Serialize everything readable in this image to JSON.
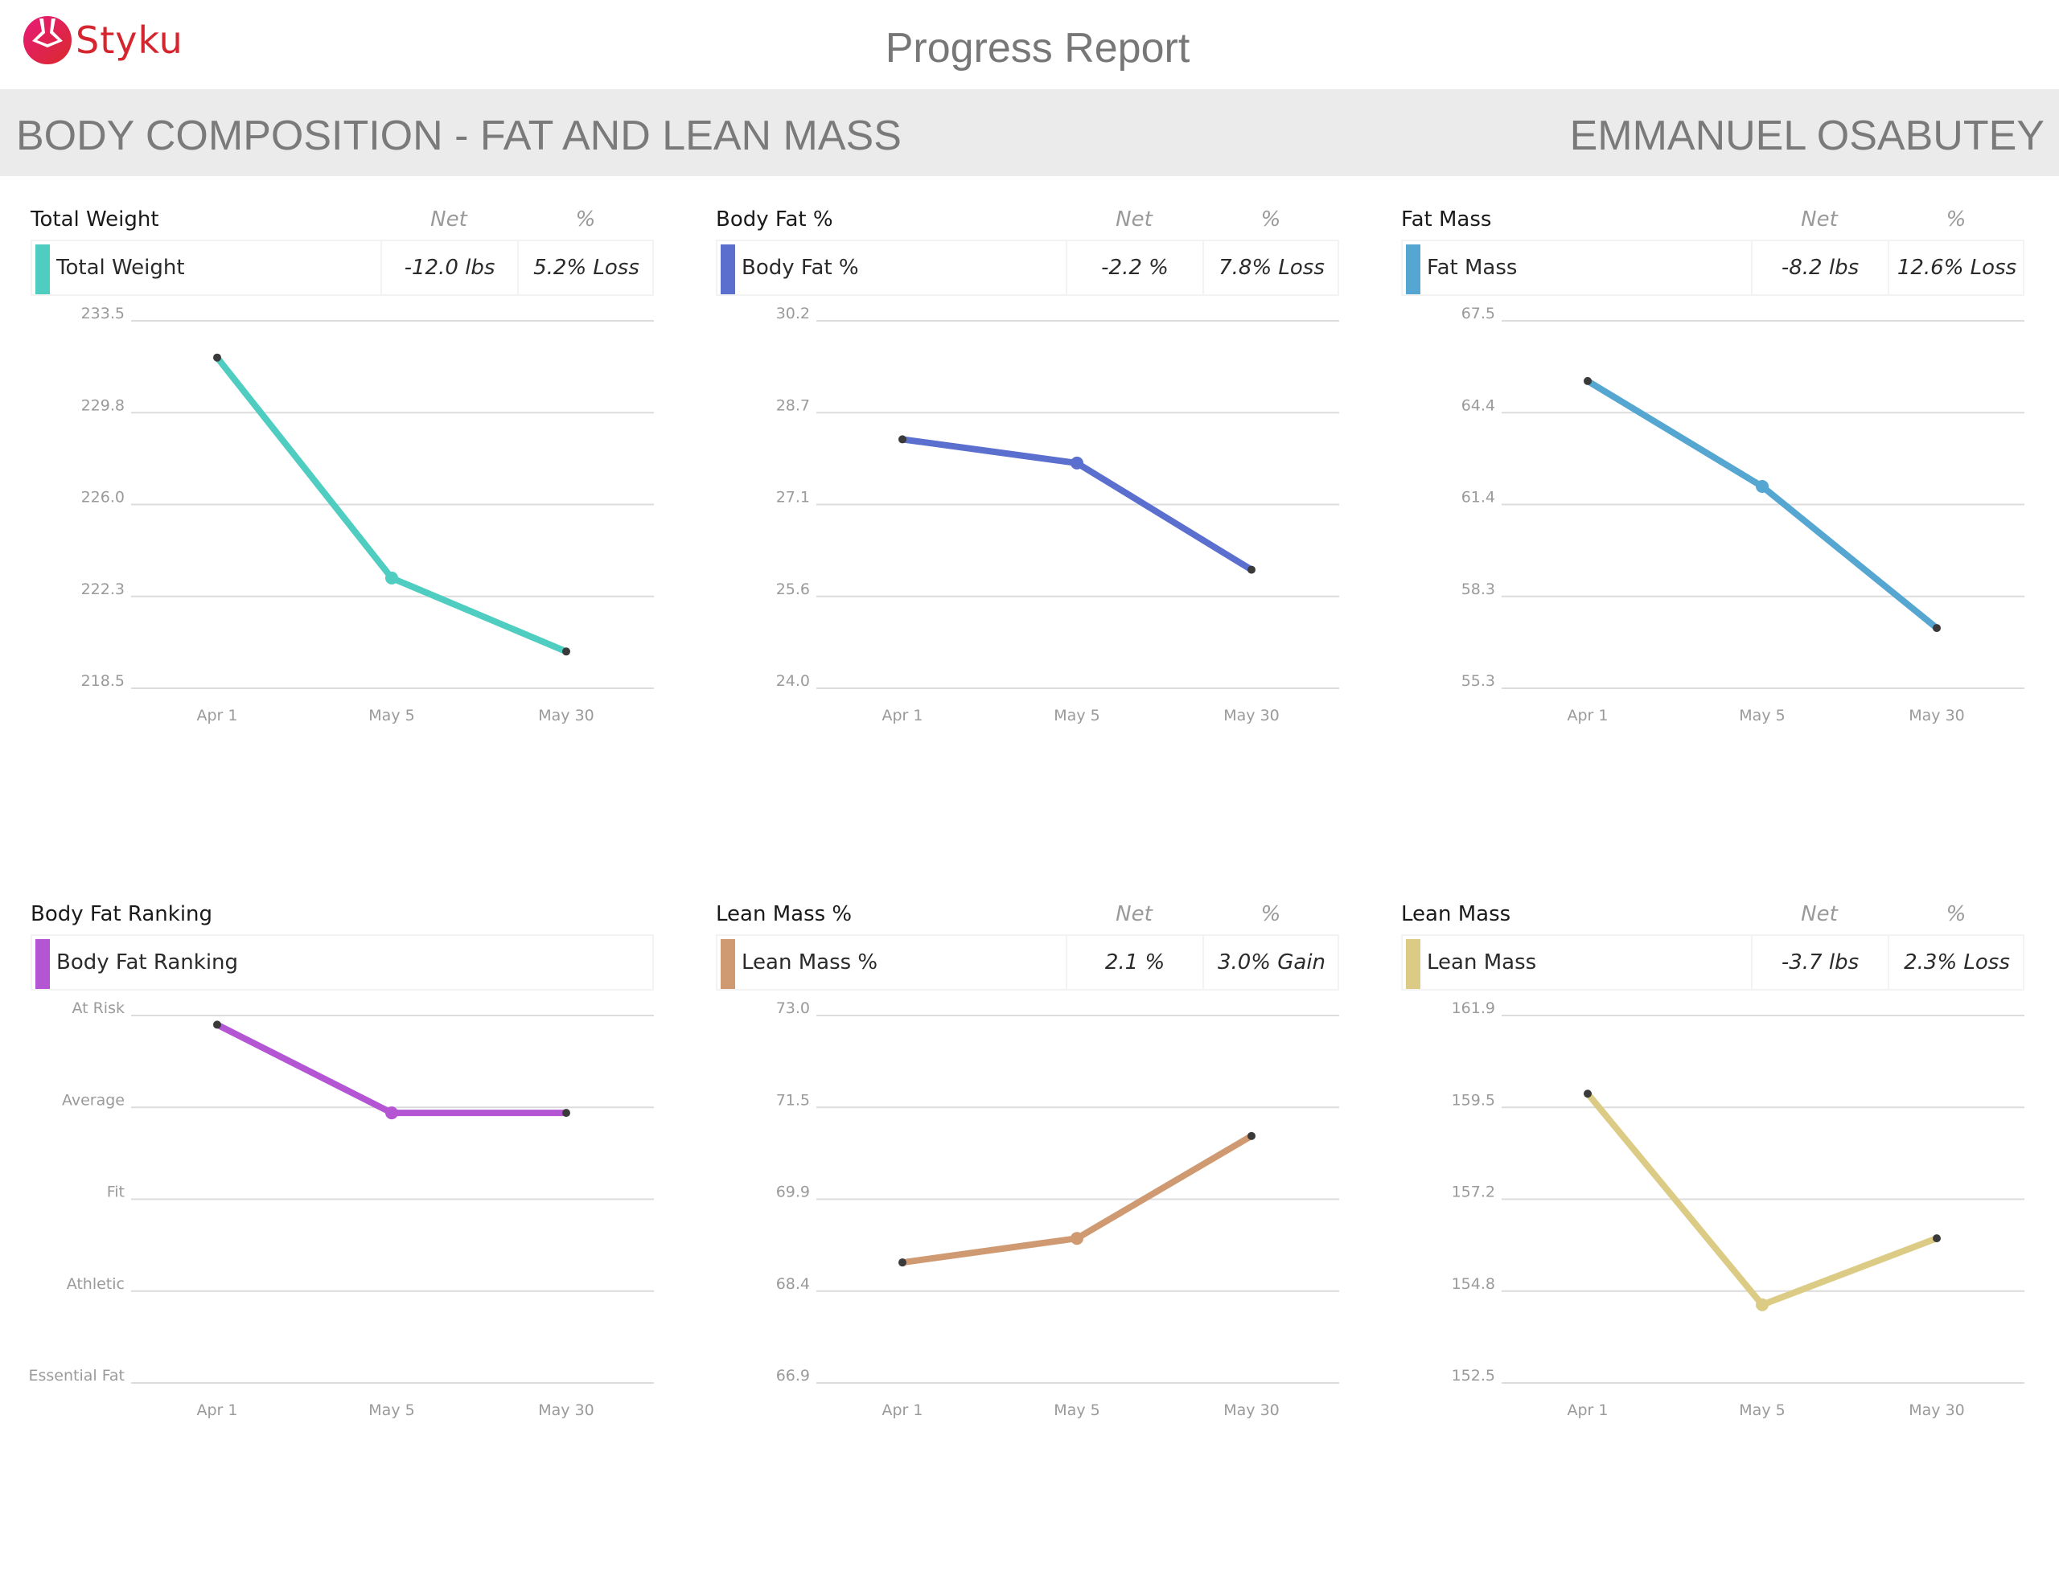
{
  "header": {
    "brand": "Styku",
    "report_title": "Progress Report",
    "section_title": "BODY COMPOSITION - FAT AND LEAN MASS",
    "client_name": "EMMANUEL OSABUTEY"
  },
  "table_headers": {
    "net": "Net",
    "pct": "%"
  },
  "panels": [
    {
      "title": "Total Weight",
      "row_label": "Total Weight",
      "net": "-12.0 lbs",
      "pct": "5.2% Loss",
      "color": "#4ecdc0"
    },
    {
      "title": "Body Fat %",
      "row_label": "Body Fat %",
      "net": "-2.2 %",
      "pct": "7.8% Loss",
      "color": "#5b6fcf"
    },
    {
      "title": "Fat Mass",
      "row_label": "Fat Mass",
      "net": "-8.2 lbs",
      "pct": "12.6% Loss",
      "color": "#55a6d0"
    },
    {
      "title": "Body Fat Ranking",
      "row_label": "Body Fat Ranking",
      "net": "",
      "pct": "",
      "color": "#b455d4"
    },
    {
      "title": "Lean Mass %",
      "row_label": "Lean Mass %",
      "net": "2.1 %",
      "pct": "3.0% Gain",
      "color": "#cf9a72"
    },
    {
      "title": "Lean Mass",
      "row_label": "Lean Mass",
      "net": "-3.7 lbs",
      "pct": "2.3% Loss",
      "color": "#dccb85"
    }
  ],
  "chart_data": [
    {
      "type": "line",
      "title": "Total Weight",
      "categories": [
        "Apr 1",
        "May 5",
        "May 30"
      ],
      "values": [
        232.0,
        223.0,
        220.0
      ],
      "yticks": [
        "233.5",
        "229.8",
        "226.0",
        "222.3",
        "218.5"
      ],
      "ylim": [
        218.5,
        233.5
      ],
      "grid": true
    },
    {
      "type": "line",
      "title": "Body Fat %",
      "categories": [
        "Apr 1",
        "May 5",
        "May 30"
      ],
      "values": [
        28.2,
        27.8,
        26.0
      ],
      "yticks": [
        "30.2",
        "28.7",
        "27.1",
        "25.6",
        "24.0"
      ],
      "ylim": [
        24.0,
        30.2
      ],
      "grid": true
    },
    {
      "type": "line",
      "title": "Fat Mass",
      "categories": [
        "Apr 1",
        "May 5",
        "May 30"
      ],
      "values": [
        65.5,
        62.0,
        57.3
      ],
      "yticks": [
        "67.5",
        "64.4",
        "61.4",
        "58.3",
        "55.3"
      ],
      "ylim": [
        55.3,
        67.5
      ],
      "grid": true
    },
    {
      "type": "line",
      "title": "Body Fat Ranking",
      "categories": [
        "Apr 1",
        "May 5",
        "May 30"
      ],
      "values": [
        3.9,
        2.94,
        2.94
      ],
      "yticks": [
        "At Risk",
        "Average",
        "Fit",
        "Athletic",
        "Essential Fat"
      ],
      "ylim": [
        0,
        4
      ],
      "ycategory_index": "Essential Fat=0, Athletic=1, Fit=2, Average=3, At Risk=4",
      "grid": true
    },
    {
      "type": "line",
      "title": "Lean Mass %",
      "categories": [
        "Apr 1",
        "May 5",
        "May 30"
      ],
      "values": [
        68.9,
        69.3,
        71.0
      ],
      "yticks": [
        "73.0",
        "71.5",
        "69.9",
        "68.4",
        "66.9"
      ],
      "ylim": [
        66.9,
        73.0
      ],
      "grid": true
    },
    {
      "type": "line",
      "title": "Lean Mass",
      "categories": [
        "Apr 1",
        "May 5",
        "May 30"
      ],
      "values": [
        159.9,
        154.5,
        156.2
      ],
      "yticks": [
        "161.9",
        "159.5",
        "157.2",
        "154.8",
        "152.5"
      ],
      "ylim": [
        152.5,
        161.9
      ],
      "grid": true
    }
  ]
}
